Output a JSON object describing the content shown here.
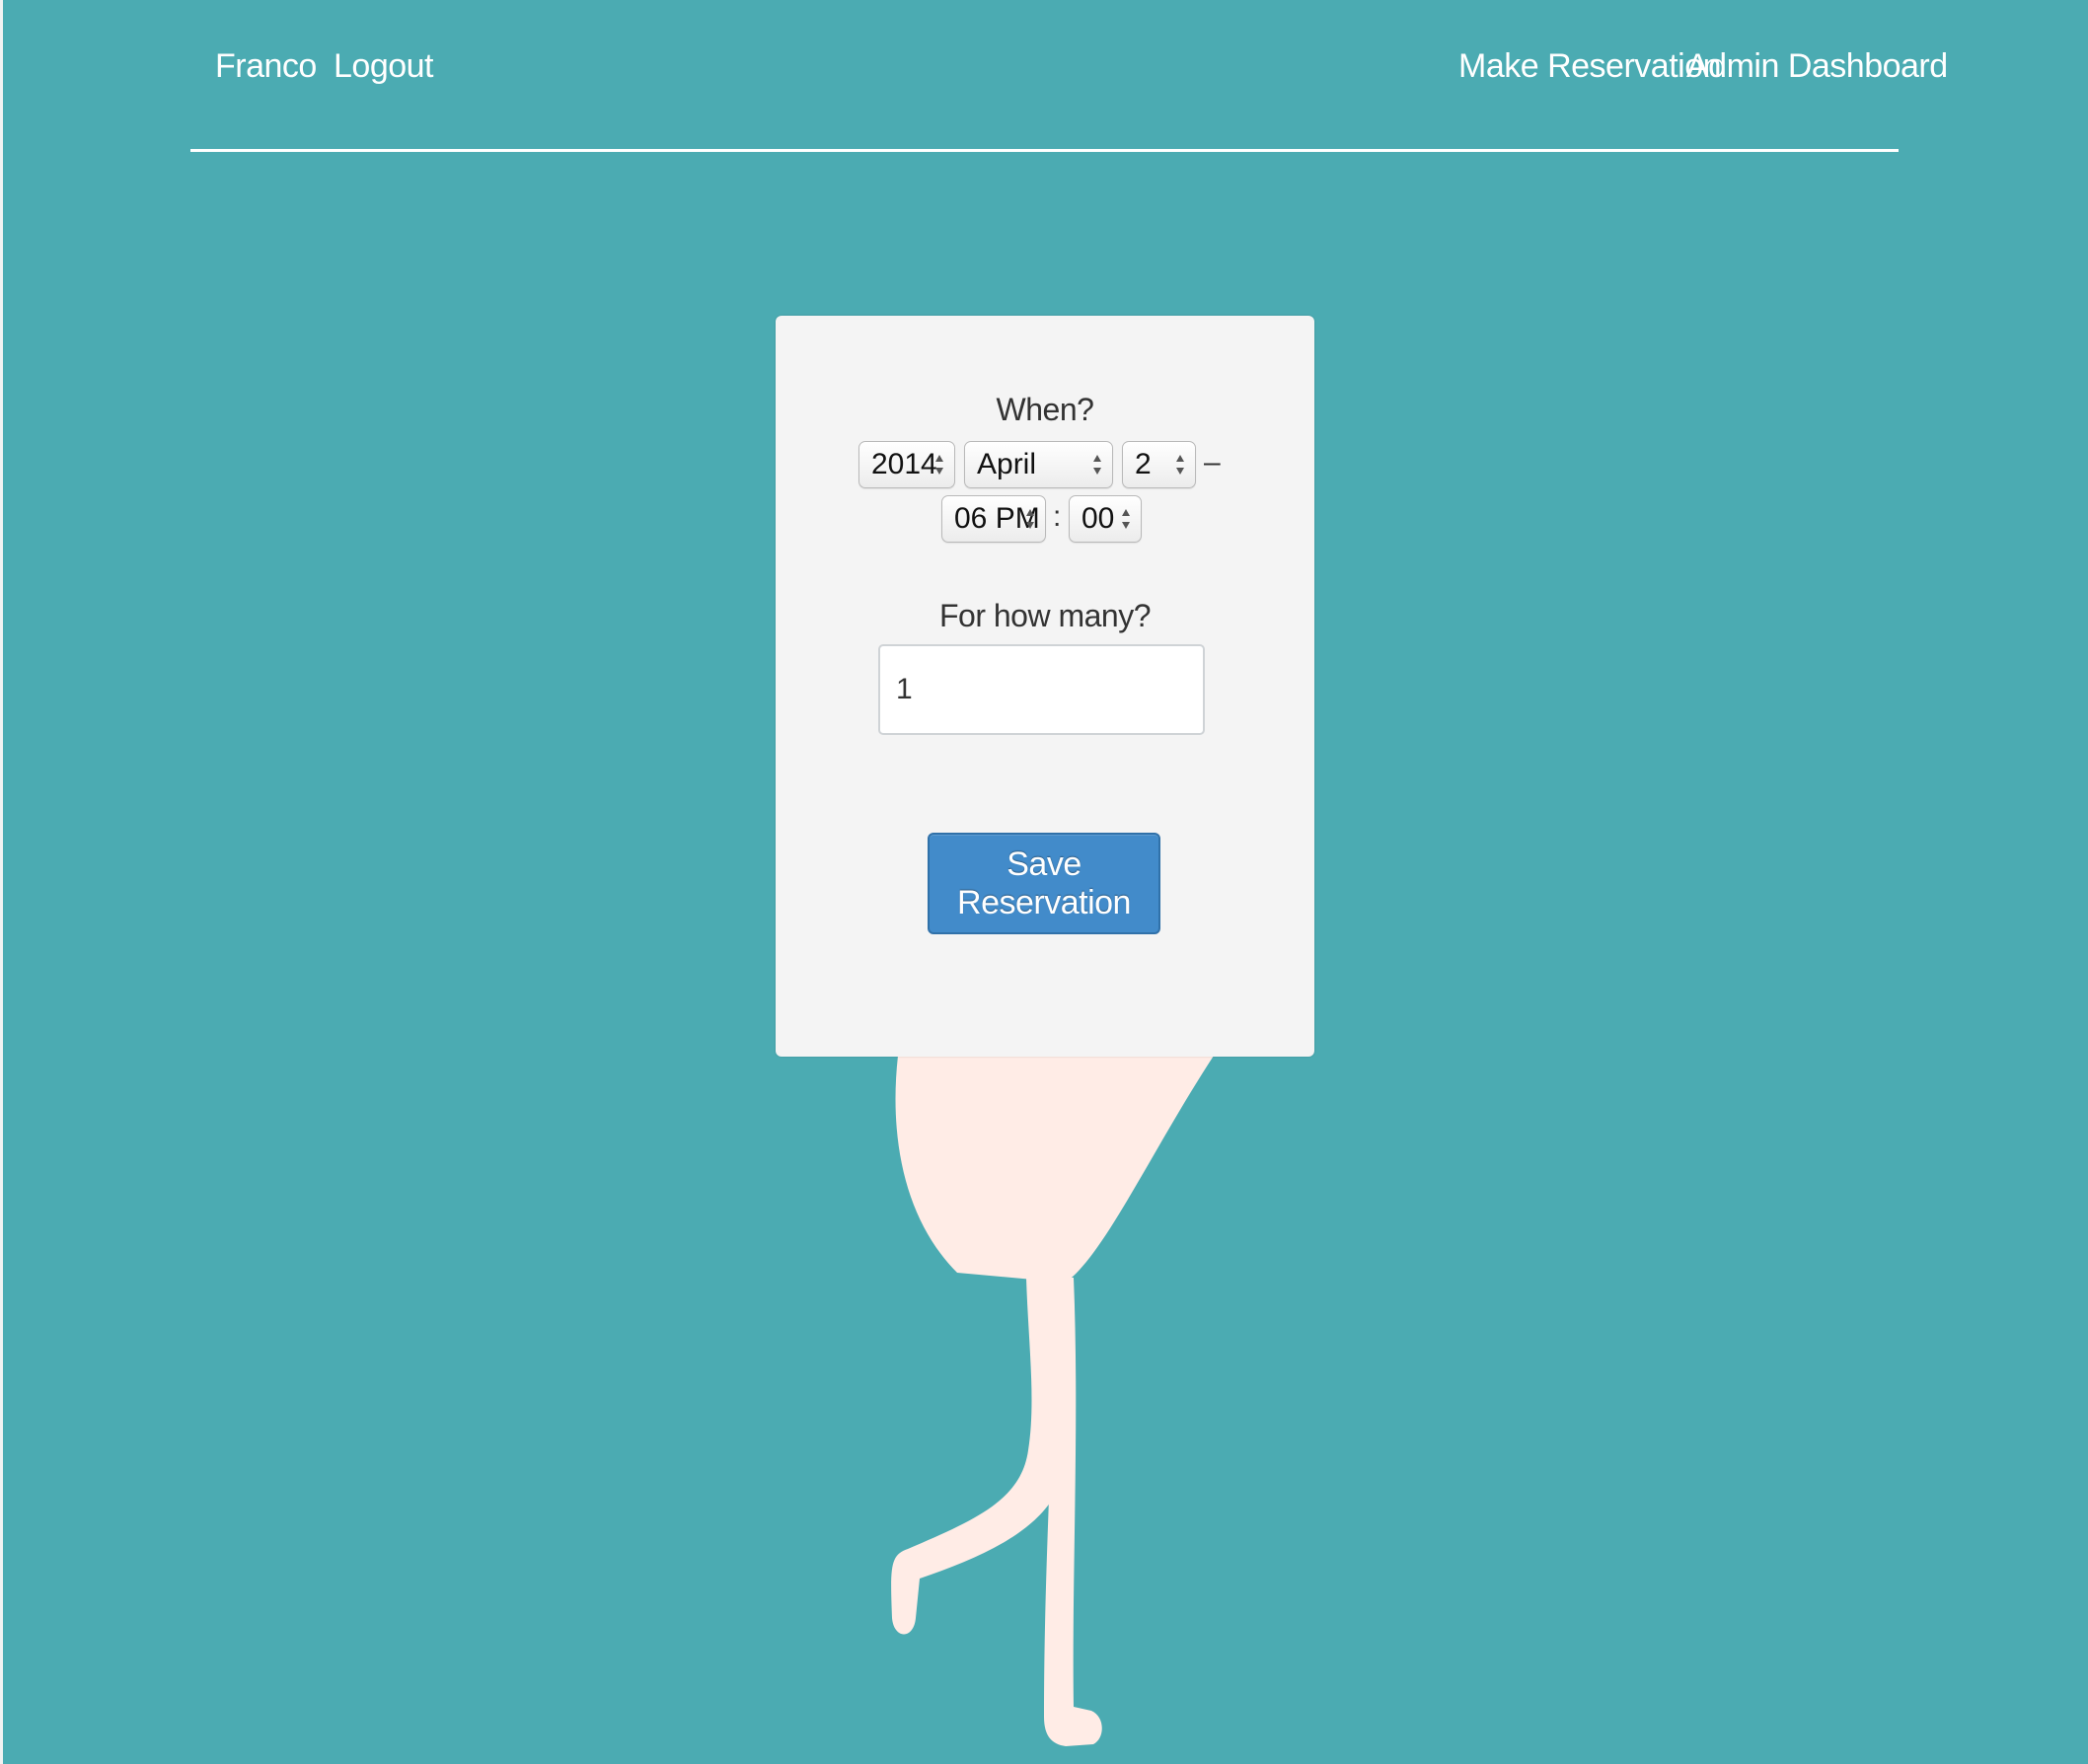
{
  "nav": {
    "user": "Franco",
    "logout": "Logout",
    "make_reservation": "Make Reservation",
    "admin_dashboard": "Admin Dashboard"
  },
  "form": {
    "when_label": "When?",
    "year": "2014",
    "month": "April",
    "day": "2",
    "date_time_separator": "–",
    "hour": "06 PM",
    "time_separator": ":",
    "minute": "00",
    "count_label": "For how many?",
    "count_value": "1",
    "save_label": "Save Reservation"
  },
  "colors": {
    "background": "#4babb2",
    "card": "#f4f4f4",
    "button": "#428bca",
    "figure": "#ffece6"
  }
}
